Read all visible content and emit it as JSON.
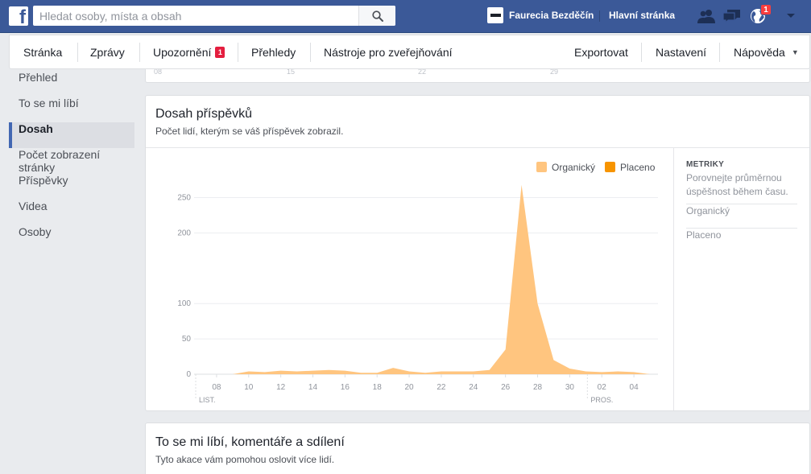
{
  "topbar": {
    "logo_letter": "f",
    "search_placeholder": "Hledat osoby, místa a obsah",
    "page_name": "Faurecia Bezděčín",
    "home_label": "Hlavní stránka",
    "notifications_count": "1"
  },
  "subnav": {
    "left": [
      {
        "label": "Stránka"
      },
      {
        "label": "Zprávy"
      },
      {
        "label": "Upozornění",
        "badge": "1"
      },
      {
        "label": "Přehledy"
      },
      {
        "label": "Nástroje pro zveřejňování"
      }
    ],
    "right": [
      {
        "label": "Exportovat"
      },
      {
        "label": "Nastavení"
      },
      {
        "label": "Nápověda"
      }
    ]
  },
  "sidebar": {
    "items": [
      {
        "label": "Přehled"
      },
      {
        "label": "To se mi líbí"
      },
      {
        "label": "Dosah"
      },
      {
        "label": "Počet zobrazení stránky"
      },
      {
        "label": "Příspěvky"
      },
      {
        "label": "Videa"
      },
      {
        "label": "Osoby"
      }
    ],
    "active_index": 2
  },
  "top_stub": {
    "ticks": [
      "08",
      "15",
      "22",
      "29"
    ]
  },
  "reach_card": {
    "title": "Dosah příspěvků",
    "subtitle": "Počet lidí, kterým se váš příspěvek zobrazil.",
    "metrics": {
      "title": "METRIKY",
      "description": "Porovnejte průměrnou úspěšnost během času.",
      "items": [
        "Organický",
        "Placeno"
      ]
    }
  },
  "engage_card": {
    "title": "To se mi líbí, komentáře a sdílení",
    "subtitle": "Tyto akace vám pomohou oslovit více lidí."
  },
  "colors": {
    "organic": "#ffc57f",
    "paid": "#f79400",
    "brand": "#3b5998"
  },
  "chart_data": {
    "type": "area",
    "y_ticks": [
      0,
      50,
      100,
      200,
      250
    ],
    "x_ticks": [
      "08",
      "10",
      "12",
      "14",
      "16",
      "18",
      "20",
      "22",
      "24",
      "26",
      "28",
      "30",
      "02",
      "04"
    ],
    "x_tick_days": [
      8,
      10,
      12,
      14,
      16,
      18,
      20,
      22,
      24,
      26,
      28,
      30,
      32,
      34
    ],
    "month_labels": [
      {
        "label": "LIST.",
        "day": 8
      },
      {
        "label": "PROS.",
        "day": 31
      }
    ],
    "ylim": [
      0,
      270
    ],
    "xlim": [
      6.6,
      35.5
    ],
    "legend": [
      {
        "name": "Organický",
        "color": "#ffc57f"
      },
      {
        "name": "Placeno",
        "color": "#f79400"
      }
    ],
    "legend_position": "top-right",
    "series": [
      {
        "name": "Organický",
        "color": "#ffc57f",
        "x": [
          8,
          9,
          10,
          11,
          12,
          13,
          14,
          15,
          16,
          17,
          18,
          19,
          20,
          21,
          22,
          23,
          24,
          25,
          26,
          27,
          28,
          29,
          30,
          31,
          32,
          33,
          34,
          35
        ],
        "values": [
          0,
          0,
          4,
          3,
          5,
          4,
          5,
          6,
          5,
          2,
          2,
          9,
          4,
          2,
          4,
          4,
          4,
          6,
          35,
          268,
          100,
          20,
          8,
          4,
          3,
          4,
          3,
          0
        ]
      },
      {
        "name": "Placeno",
        "color": "#f79400",
        "x": [
          8,
          35
        ],
        "values": [
          0,
          0
        ]
      }
    ]
  }
}
